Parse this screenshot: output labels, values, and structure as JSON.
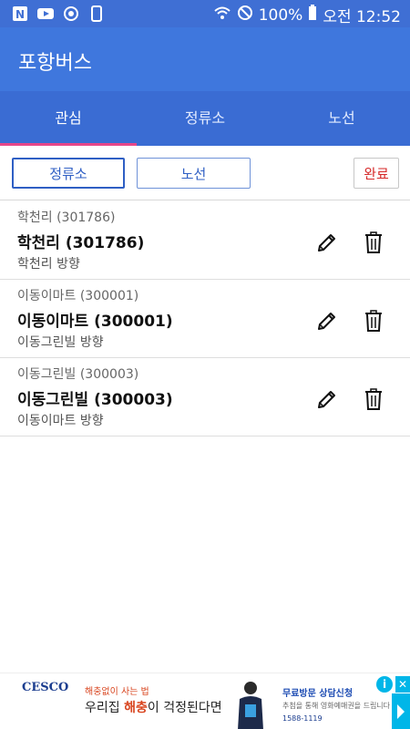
{
  "status_bar": {
    "battery_text": "100%",
    "time_text": "오전 12:52",
    "left_icons": [
      "n-app-icon",
      "youtube-icon",
      "sync-icon",
      "phone-device-icon"
    ],
    "right_icons": [
      "wifi-icon",
      "do-not-disturb-icon",
      "battery-icon"
    ]
  },
  "app_bar": {
    "title": "포항버스"
  },
  "tabs": [
    {
      "label": "관심",
      "active": true
    },
    {
      "label": "정류소",
      "active": false
    },
    {
      "label": "노선",
      "active": false
    }
  ],
  "toolbar": {
    "stop_label": "정류소",
    "route_label": "노선",
    "done_label": "완료"
  },
  "favorites": [
    {
      "subtitle": "학천리 (301786)",
      "title": "학천리 (301786)",
      "direction": "학천리 방향"
    },
    {
      "subtitle": "이동이마트 (300001)",
      "title": "이동이마트 (300001)",
      "direction": "이동그린빌 방향"
    },
    {
      "subtitle": "이동그린빌 (300003)",
      "title": "이동그린빌 (300003)",
      "direction": "이동이마트 방향"
    }
  ],
  "ad": {
    "logo": "CESCO",
    "small_text": "해충없이 사는 법",
    "main_prefix": "우리집 ",
    "main_highlight": "해충",
    "main_suffix": "이 걱정된다면",
    "right_line1": "무료방문 상담신청",
    "right_line2": "추첨을 통해 영화예매권을 드립니다",
    "right_line3": "1588-1119"
  },
  "colors": {
    "app_bar": "#3f77dd",
    "tab_bar": "#3a6cd3",
    "tab_indicator": "#e6478a",
    "done_text": "#d62a2a"
  }
}
